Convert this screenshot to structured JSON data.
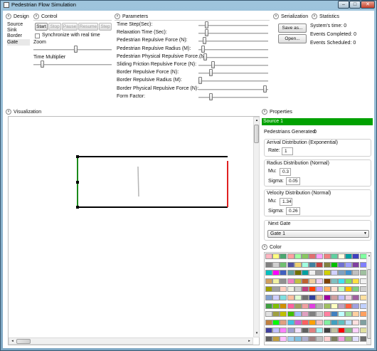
{
  "window": {
    "title": "Pedestrian Flow Simulation",
    "min_glyph": "–",
    "max_glyph": "□",
    "close_glyph": "✕"
  },
  "design": {
    "header": "Design",
    "items": [
      "Source",
      "Sink",
      "Border",
      "Gate"
    ]
  },
  "control": {
    "header": "Control",
    "buttons": {
      "start": "Start",
      "stop": "Stop",
      "pause": "Pause",
      "resume": "Resume",
      "step": "Step"
    },
    "sync_label": "Synchronize with real time",
    "zoom_label": "Zoom",
    "zoom_level": 0.55,
    "time_multiplier_label": "Time Multiplier",
    "time_multiplier_level": 0.1
  },
  "parameters": {
    "header": "Parameters",
    "items": [
      {
        "label": "Time Step(Sec):",
        "level": 0.1
      },
      {
        "label": "Relaxation Time (Sec):",
        "level": 0.1
      },
      {
        "label": "Pedestrian Repulsive Force (N):",
        "level": 0.06
      },
      {
        "label": "Pedestrian Repulsive Radius (M):",
        "level": 0.04
      },
      {
        "label": "Pedestrian Physical Repulsive Force (N):",
        "level": 0.08
      },
      {
        "label": "Sliding Friction Repulsive Force (N):",
        "level": 0.2
      },
      {
        "label": "Border Repulsive Force (N):",
        "level": 0.16
      },
      {
        "label": "Border Repulsive Radius (M):",
        "level": 0.0
      },
      {
        "label": "Border Physical Repulsive Force (N):",
        "level": 0.99
      },
      {
        "label": "Form Factor:",
        "level": 0.16
      }
    ]
  },
  "serialization": {
    "header": "Serialization",
    "save_label": "Save as...",
    "open_label": "Open..."
  },
  "statistics": {
    "header": "Statistics",
    "system_time": "System's time: 0",
    "events_completed": "Events Completed: 0",
    "events_scheduled": "Events Scheduled: 0"
  },
  "visualization": {
    "header": "Visualization"
  },
  "properties": {
    "header": "Properties",
    "selected": "Source 1",
    "pedestrians_generated_label": "Pedestrians Generated:",
    "pedestrians_generated_value": "0",
    "arrival": {
      "title": "Arrival Distribution (Exponential)",
      "rate_label": "Rate:",
      "rate_value": "1"
    },
    "radius": {
      "title": "Radius Distribution (Normal)",
      "mu_label": "Mu:",
      "mu_value": "0.3",
      "sigma_label": "Sigma:",
      "sigma_value": "0.05"
    },
    "velocity": {
      "title": "Velocity Distribution (Normal)",
      "mu_label": "Mu:",
      "mu_value": "1.34",
      "sigma_label": "Sigma:",
      "sigma_value": "0.26"
    },
    "next_gate_label": "Next Gate",
    "next_gate_value": "Gate 1"
  },
  "color": {
    "header": "Color",
    "palette": [
      [
        "#ffb6c1",
        "#ffff80",
        "#4aa870",
        "#ffa0a0",
        "#a0ffa0",
        "#88c860",
        "#e07070",
        "#ffa0ff",
        "#f08080",
        "#60d0a0",
        "#ffffe0",
        "#00a0a0",
        "#4040c0",
        "#80ffa0"
      ],
      [
        "#808080",
        "#d0d0d0",
        "#70c070",
        "#5050a0",
        "#f0d070",
        "#a0ffe0",
        "#4080a0",
        "#c04040",
        "#808040",
        "#00c000",
        "#7070d0",
        "#a0a0ff",
        "#8040a0",
        "#8080ff"
      ],
      [
        "#00c0c0",
        "#ff00ff",
        "#4060c0",
        "#60a0a0",
        "#707000",
        "#00a0a0",
        "#f0f0f0",
        "#a0a0a0",
        "#d0d000",
        "#d0d0ff",
        "#80a0c0",
        "#4090d0",
        "#c0c0c0",
        "#a0c0a0"
      ],
      [
        "#d0a060",
        "#f0f0a0",
        "#909090",
        "#f080c0",
        "#c0c040",
        "#c06030",
        "#f0d0a0",
        "#f0d0f0",
        "#804000",
        "#80c0c0",
        "#40e0f0",
        "#80e060",
        "#ffe040",
        "#f0f0f0"
      ],
      [
        "#a0a000",
        "#a0a0a0",
        "#ffd0c0",
        "#f0f0e0",
        "#d0d0d0",
        "#c04080",
        "#ff4000",
        "#c0a0ff",
        "#ffb060",
        "#ffe0d0",
        "#c0ffc0",
        "#ffc000",
        "#80d080",
        "#d0d0d0"
      ],
      [
        "#80a0d0",
        "#d0d0ff",
        "#80e0e0",
        "#ffc0a0",
        "#e0ffd0",
        "#707070",
        "#3040a0",
        "#e0c0a0",
        "#a000a0",
        "#d0a0a0",
        "#c0c0ff",
        "#f0d0e0",
        "#a060a0",
        "#ffe0a0"
      ],
      [
        "#40a040",
        "#80c000",
        "#d09000",
        "#ff60a0",
        "#a0a060",
        "#f0a0a0",
        "#e040e0",
        "#b0b0b0",
        "#a0c060",
        "#ffffc0",
        "#c0a0c0",
        "#ff6040",
        "#a0a0e0",
        "#c0d0ff"
      ],
      [
        "#e0e0e0",
        "#a0a040",
        "#c0c000",
        "#40c000",
        "#a0c0ff",
        "#e0a0c0",
        "#808080",
        "#d0d0d0",
        "#ff80a0",
        "#4080c0",
        "#c0ffff",
        "#a0e0a0",
        "#ffd0a0",
        "#ffa060"
      ],
      [
        "#c08040",
        "#00ff00",
        "#e0a080",
        "#40c0e0",
        "#d060d0",
        "#ff6060",
        "#ffa000",
        "#f0c0c0",
        "#80f0a0",
        "#40a0c0",
        "#60c0c0",
        "#c0e0ff",
        "#ffe0e0",
        "#80a0a0"
      ],
      [
        "#4040a0",
        "#c0c0ff",
        "#ff80ff",
        "#a0a0d0",
        "#f0e0ff",
        "#606060",
        "#e08080",
        "#a0f0f0",
        "#404040",
        "#c0c0a0",
        "#ff0000",
        "#80c080",
        "#ffd0ff",
        "#e0e0a0"
      ],
      [
        "#606060",
        "#c0a040",
        "#ffc0ff",
        "#a0d0f0",
        "#80c0e0",
        "#b0b0d0",
        "#a08080",
        "#c0c0c0",
        "#ffd0d0",
        "#808060",
        "#f0a0e0",
        "#a0c080",
        "#e0e0ff",
        "#707070"
      ]
    ]
  },
  "colors": {
    "accent_selected": "#00a100",
    "exit_border": "#e02020",
    "entry_border": "#1a8a1a"
  }
}
